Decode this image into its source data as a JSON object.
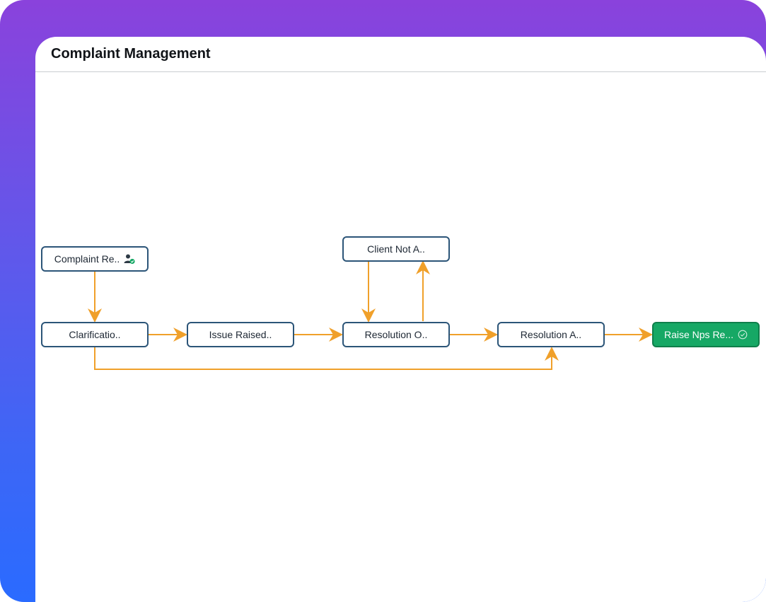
{
  "header": {
    "title": "Complaint Management"
  },
  "diagram": {
    "nodes": [
      {
        "id": "complaint",
        "label": "Complaint Re..",
        "icon": "user-check-icon"
      },
      {
        "id": "clarification",
        "label": "Clarificatio.."
      },
      {
        "id": "issue",
        "label": "Issue Raised.."
      },
      {
        "id": "resolution_o",
        "label": "Resolution O.."
      },
      {
        "id": "client_not",
        "label": "Client Not A.."
      },
      {
        "id": "resolution_a",
        "label": "Resolution A.."
      },
      {
        "id": "raise_nps",
        "label": "Raise Nps Re...",
        "icon": "check-circle-icon",
        "status": "completed"
      }
    ],
    "edges": [
      {
        "from": "complaint",
        "to": "clarification"
      },
      {
        "from": "clarification",
        "to": "issue"
      },
      {
        "from": "issue",
        "to": "resolution_o"
      },
      {
        "from": "client_not",
        "to": "resolution_o"
      },
      {
        "from": "resolution_o",
        "to": "client_not"
      },
      {
        "from": "resolution_o",
        "to": "resolution_a"
      },
      {
        "from": "clarification",
        "to": "resolution_a"
      },
      {
        "from": "resolution_a",
        "to": "raise_nps"
      }
    ],
    "colors": {
      "edge": "#f0a02a",
      "node_border": "#2c5578",
      "completed_fill": "#16a865"
    }
  }
}
